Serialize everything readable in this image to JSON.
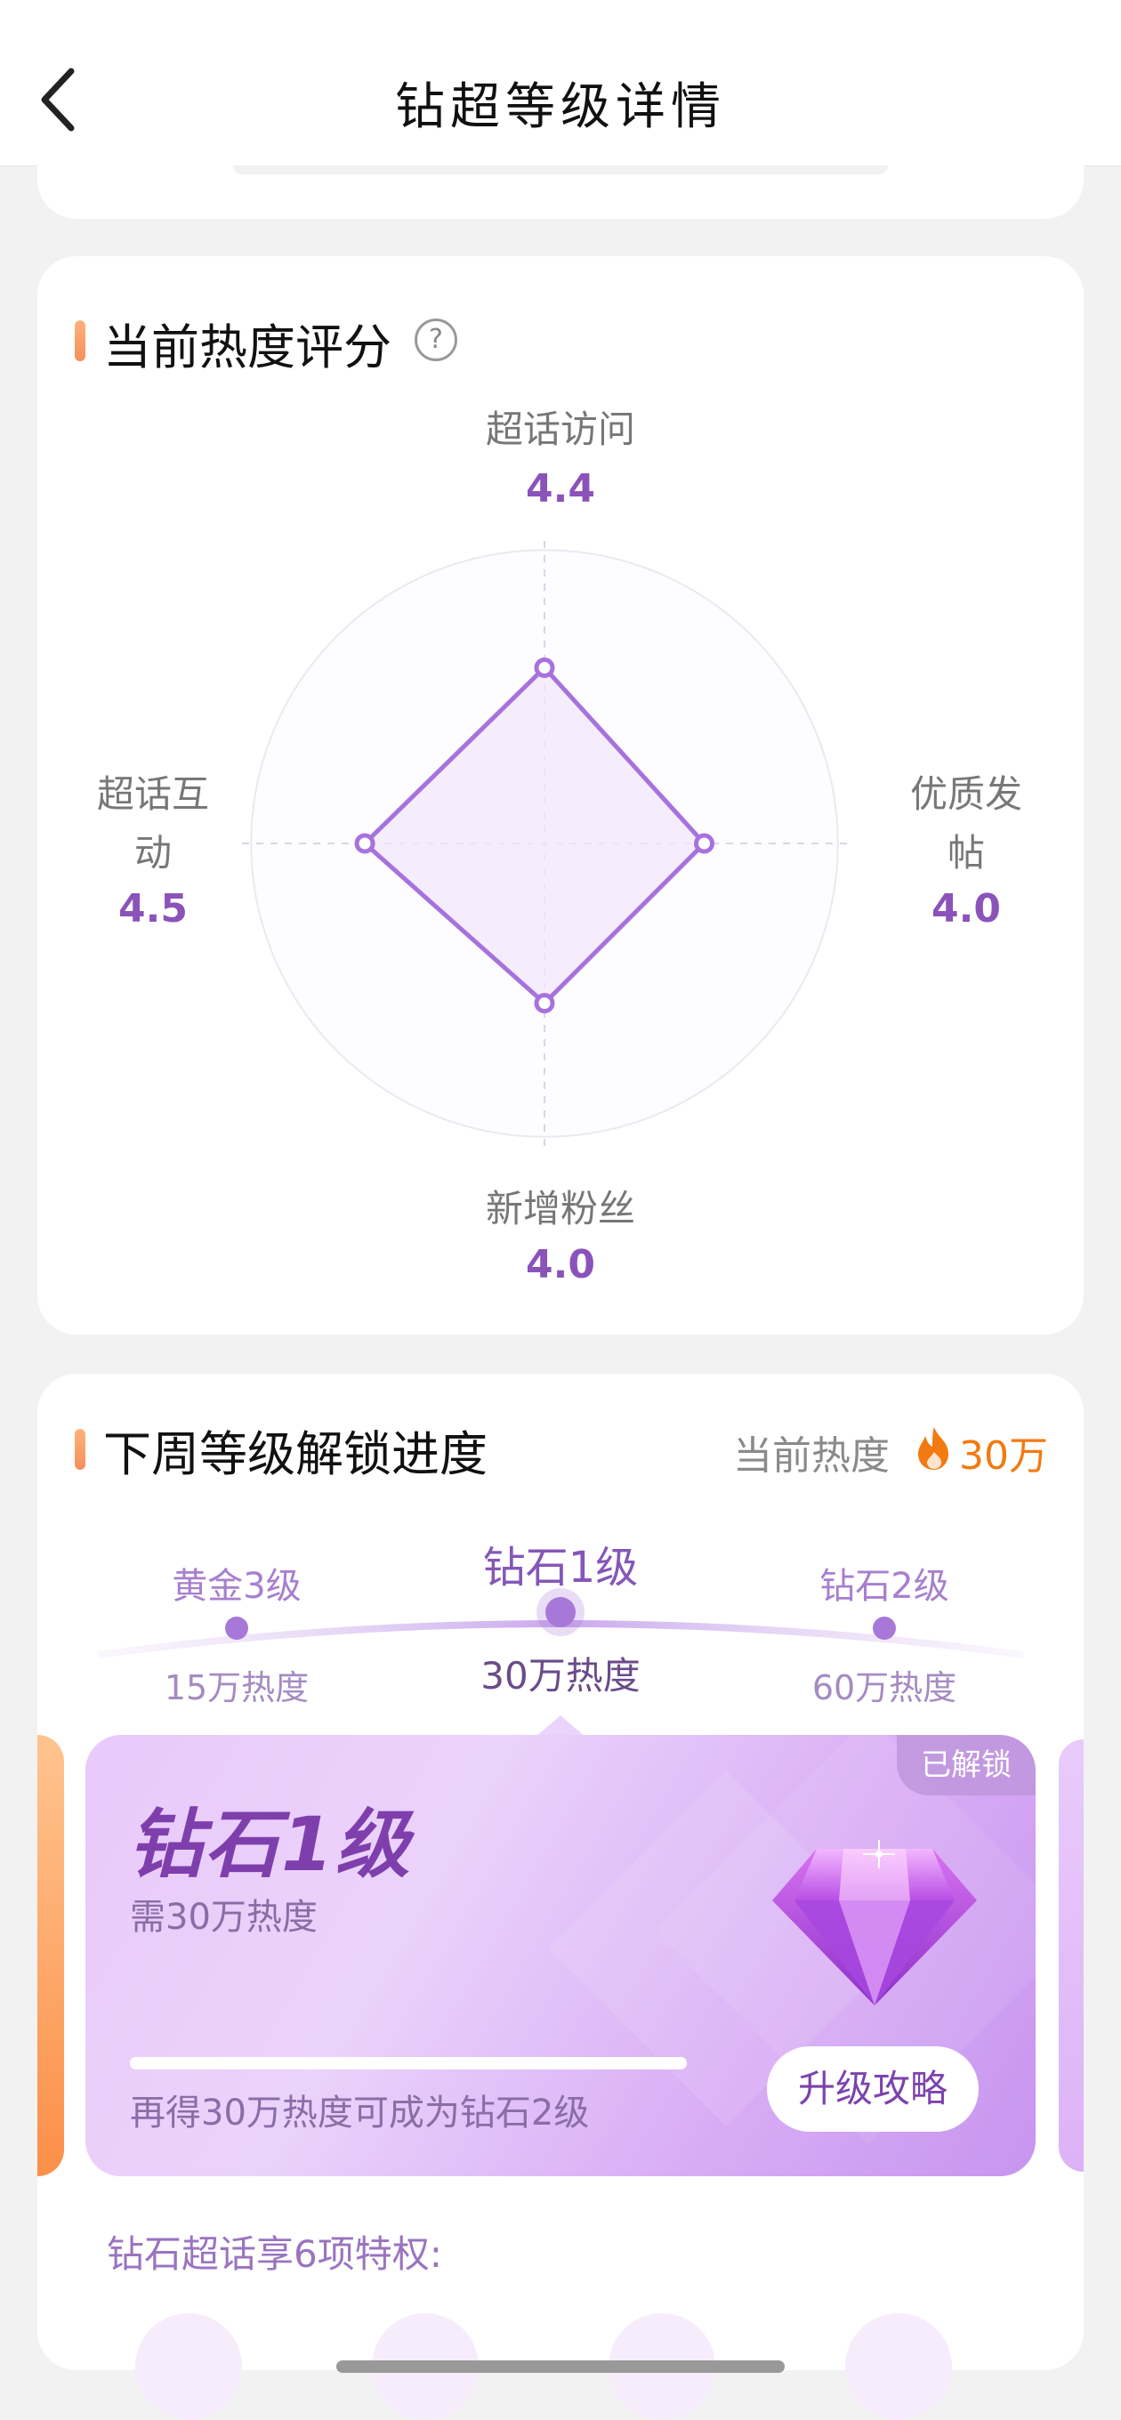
{
  "header": {
    "title": "钻超等级详情",
    "back_icon": "chevron-left-icon"
  },
  "score": {
    "title": "当前热度评分",
    "help_icon": "question-circle-icon",
    "help_symbol": "?",
    "radar": {
      "max": 5,
      "axes": [
        {
          "label": "超话访问",
          "value": "4.4",
          "score": 4.4
        },
        {
          "label": "优质发帖",
          "value": "4.0",
          "score": 4.0
        },
        {
          "label": "新增粉丝",
          "value": "4.0",
          "score": 4.0
        },
        {
          "label": "超话互动",
          "value": "4.5",
          "score": 4.5
        }
      ],
      "right_label_lines": [
        "优质发",
        "帖"
      ],
      "left_label_lines": [
        "超话互",
        "动"
      ],
      "fill_color": "#f1e8fb",
      "stroke_color": "#a772dd"
    }
  },
  "progress_section": {
    "title": "下周等级解锁进度",
    "heat_label": "当前热度",
    "heat_icon": "flame-icon",
    "heat_value": "30万",
    "levels": [
      {
        "name": "黄金3级",
        "requirement": "15万热度"
      },
      {
        "name": "钻石1级",
        "requirement": "30万热度",
        "current": true
      },
      {
        "name": "钻石2级",
        "requirement": "60万热度"
      }
    ],
    "card": {
      "title": "钻石1级",
      "subtitle": "需30万热度",
      "badge": "已解锁",
      "progress": 1.0,
      "hint": "再得30万热度可成为钻石2级",
      "button": "升级攻略",
      "gem_icon": "diamond-gem-icon"
    },
    "privileges_title": "钻石超话享6项特权:"
  }
}
